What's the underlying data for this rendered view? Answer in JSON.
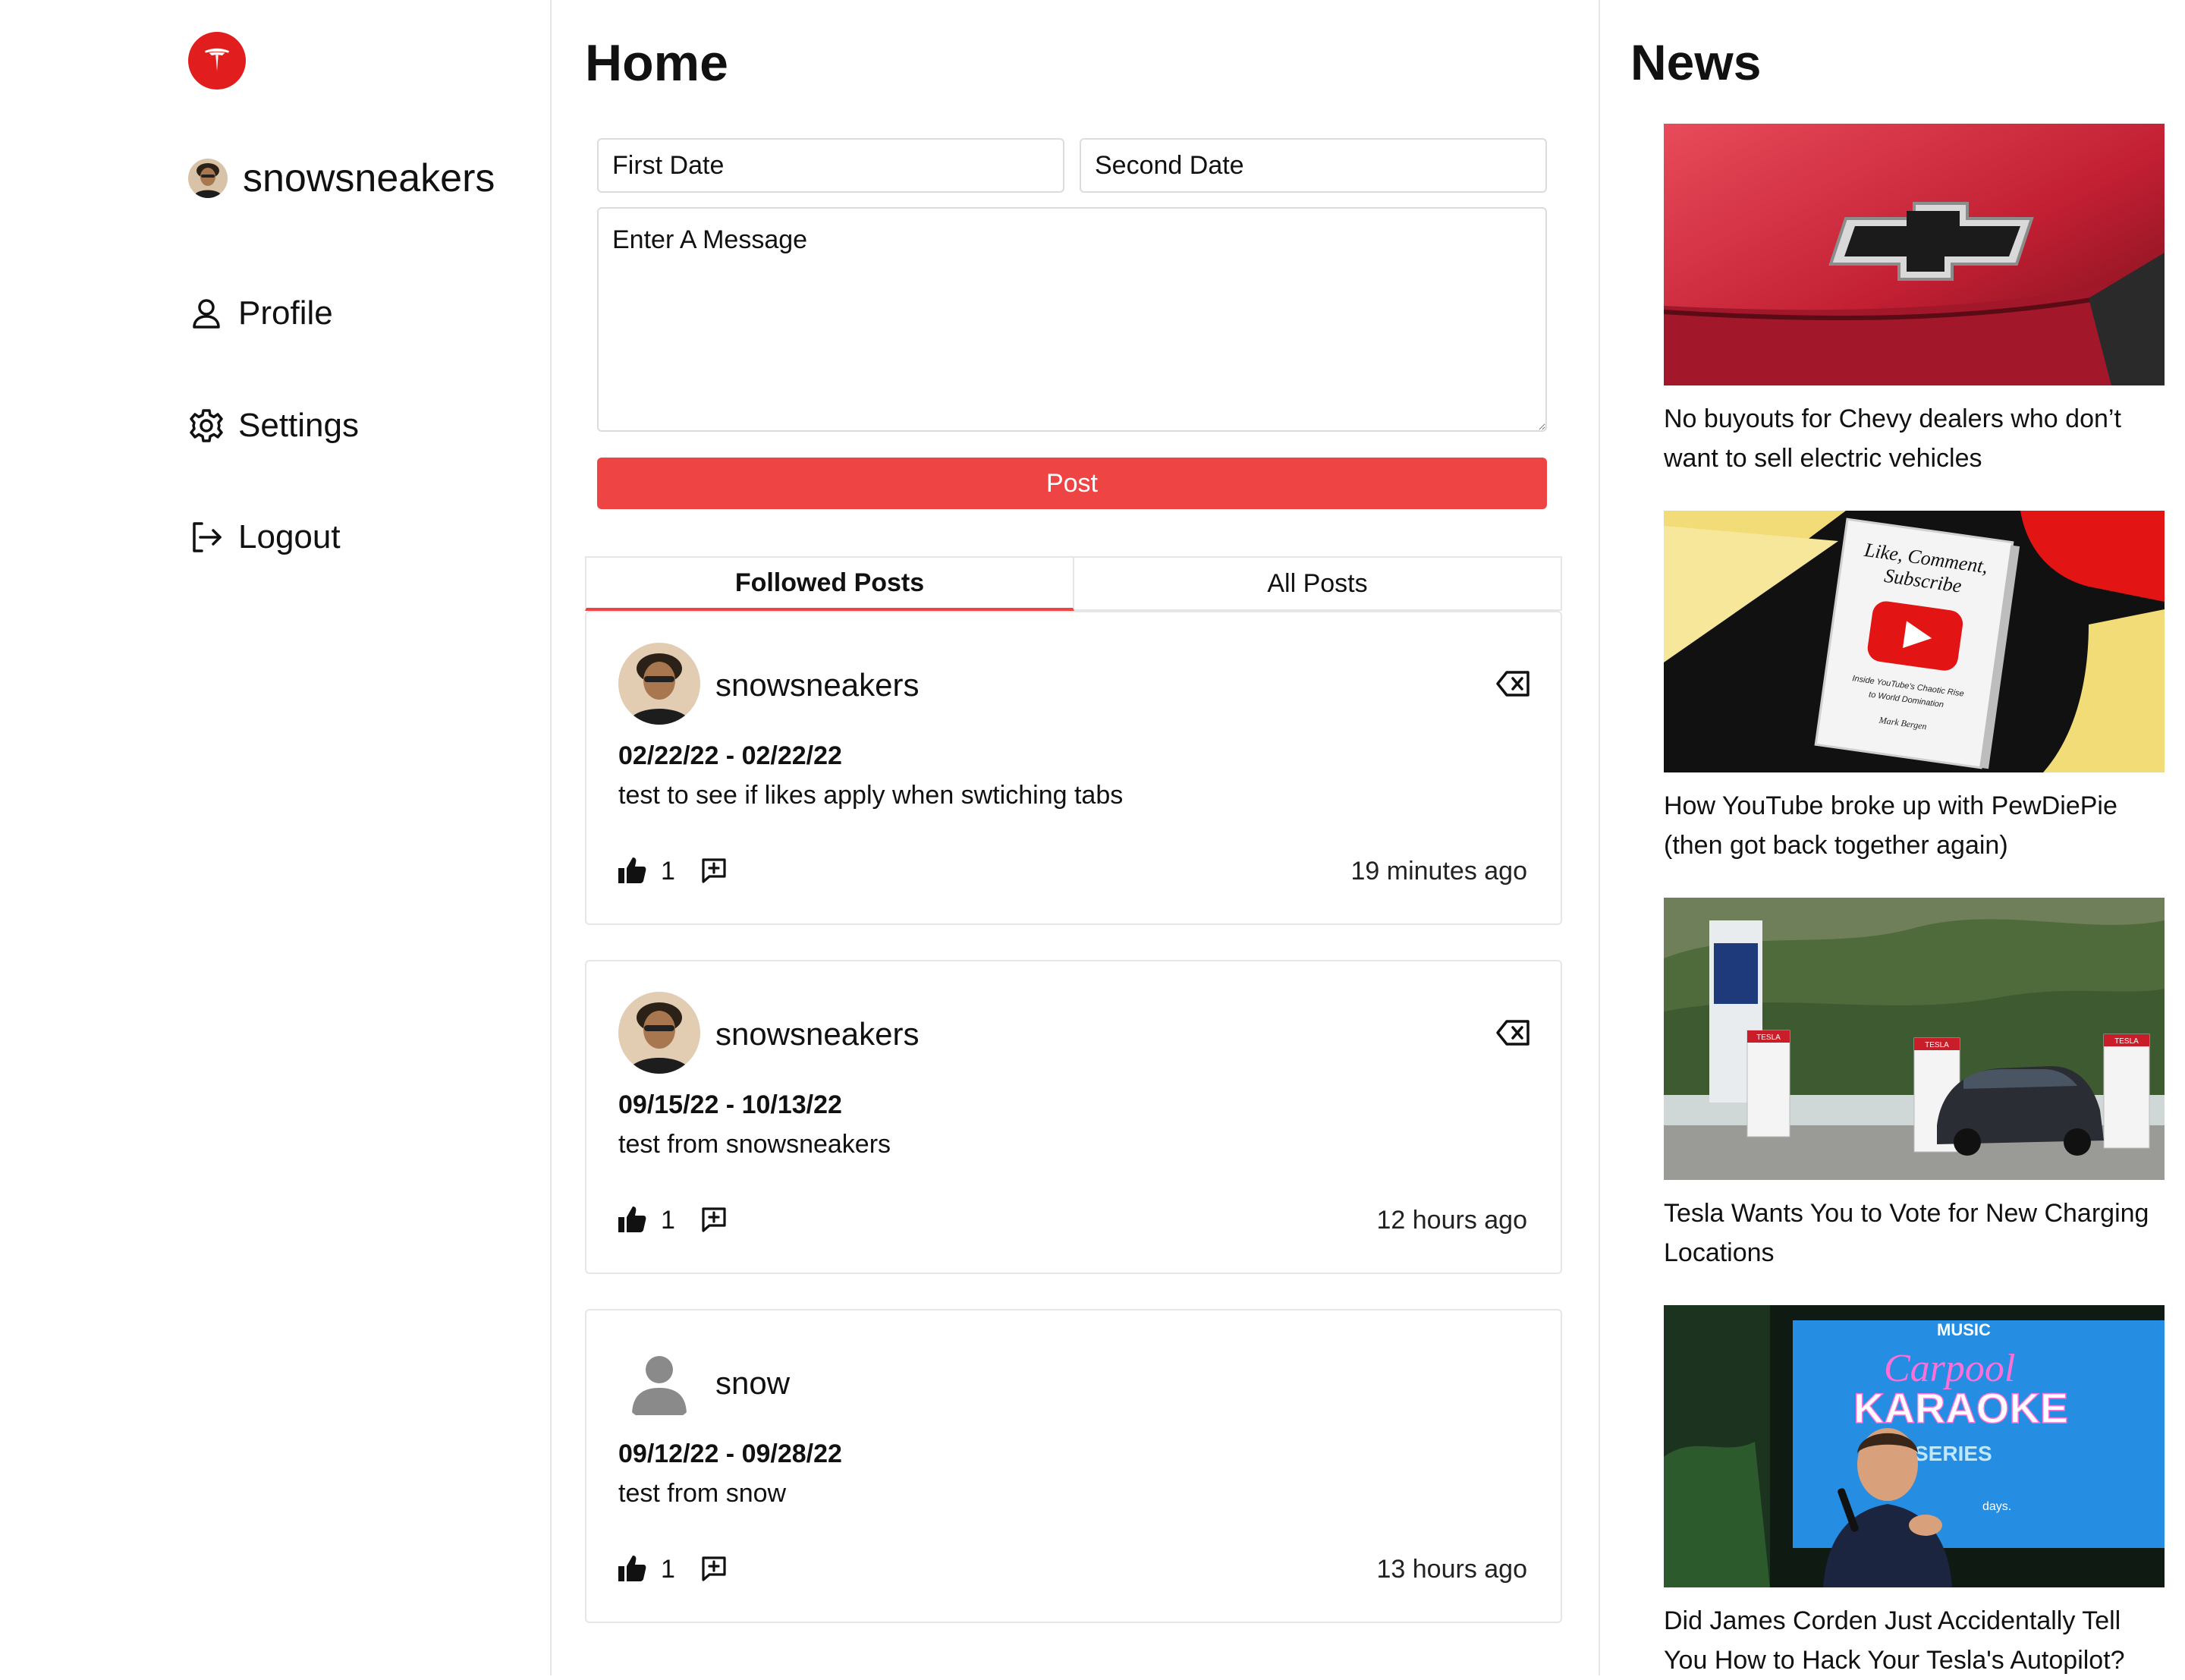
{
  "app": {
    "brand_color": "#e11d1d",
    "accent_color": "#ef4444"
  },
  "sidebar": {
    "username": "snowsneakers",
    "nav": [
      {
        "label": "Profile",
        "icon": "user-icon"
      },
      {
        "label": "Settings",
        "icon": "gear-icon"
      },
      {
        "label": "Logout",
        "icon": "logout-icon"
      }
    ]
  },
  "main": {
    "title": "Home",
    "form": {
      "first_date_placeholder": "First Date",
      "second_date_placeholder": "Second Date",
      "message_placeholder": "Enter A Message",
      "post_label": "Post"
    },
    "tabs": [
      {
        "label": "Followed Posts",
        "active": true
      },
      {
        "label": "All Posts",
        "active": false
      }
    ],
    "posts": [
      {
        "user": "snowsneakers",
        "dates": "02/22/22 - 02/22/22",
        "text": "test to see if likes apply when swtiching tabs",
        "likes": "1",
        "time": "19 minutes ago"
      },
      {
        "user": "snowsneakers",
        "dates": "09/15/22 - 10/13/22",
        "text": "test from snowsneakers",
        "likes": "1",
        "time": "12 hours ago"
      },
      {
        "user": "snow",
        "dates": "09/12/22 - 09/28/22",
        "text": "test from snow",
        "likes": "1",
        "time": "13 hours ago"
      }
    ]
  },
  "news": {
    "title": "News",
    "items": [
      {
        "headline": "No buyouts for Chevy dealers who don’t want to sell electric vehicles"
      },
      {
        "headline": "How YouTube broke up with PewDiePie (then got back together again)",
        "image_text": [
          "Like, Comment,",
          "Subscribe",
          "Inside YouTube's Chaotic Rise",
          "to World Domination",
          "Mark Bergen"
        ]
      },
      {
        "headline": "Tesla Wants You to Vote for New Charging Locations",
        "image_text": [
          "TESLA"
        ]
      },
      {
        "headline": "Did James Corden Just Accidentally Tell You How to Hack Your Tesla's Autopilot?",
        "image_text": [
          "MUSIC",
          "Carpool",
          "KARAOKE",
          "SERIES",
          "days."
        ]
      }
    ]
  }
}
